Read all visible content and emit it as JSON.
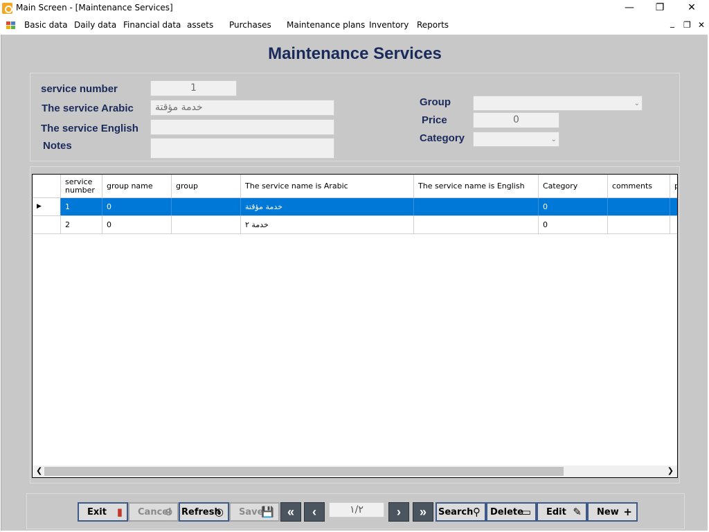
{
  "window": {
    "title": "Main Screen - [Maintenance Services]",
    "minimize": "—",
    "restore": "❐",
    "close": "✕"
  },
  "menu": {
    "items": [
      "Basic data",
      "Daily data",
      "Financial data",
      "assets",
      "Purchases",
      "Maintenance plans",
      "Inventory",
      "Reports"
    ],
    "mdi_minimize": "_",
    "mdi_restore": "❐",
    "mdi_close": "✕"
  },
  "page": {
    "title": "Maintenance Services"
  },
  "form": {
    "service_number_label": "service number",
    "service_number_value": "1",
    "service_arabic_label": "The service Arabic",
    "service_arabic_value": "خدمة مؤقتة",
    "service_english_label": "The service English",
    "service_english_value": "",
    "notes_label": "Notes",
    "notes_value": "",
    "group_label": "Group",
    "group_value": "",
    "price_label": "Price",
    "price_value": "0",
    "category_label": "Category",
    "category_value": ""
  },
  "grid": {
    "columns": [
      "service number",
      "group name",
      "group",
      "The service name is Arabic",
      "The service name is English",
      "Category",
      "comments",
      "p"
    ],
    "rows": [
      {
        "service_number": "1",
        "group_name": "0",
        "group": "",
        "name_arabic": "خدمة مؤقتة",
        "name_english": "",
        "category": "0",
        "comments": "",
        "p": ""
      },
      {
        "service_number": "2",
        "group_name": "0",
        "group": "",
        "name_arabic": "خدمة ٢",
        "name_english": "",
        "category": "0",
        "comments": "",
        "p": ""
      }
    ],
    "selected_row": 0
  },
  "toolbar": {
    "exit": "Exit",
    "cancel": "Cancel",
    "refresh": "Refresh",
    "save": "Save",
    "page_indicator": "١/٢",
    "search": "Search",
    "delete": "Delete",
    "edit": "Edit",
    "new": "New"
  },
  "colors": {
    "form_bg": "#c8c8c8",
    "title_text": "#1a2a5a",
    "selection": "#0078d7",
    "button_border": "#3d5a8a"
  }
}
